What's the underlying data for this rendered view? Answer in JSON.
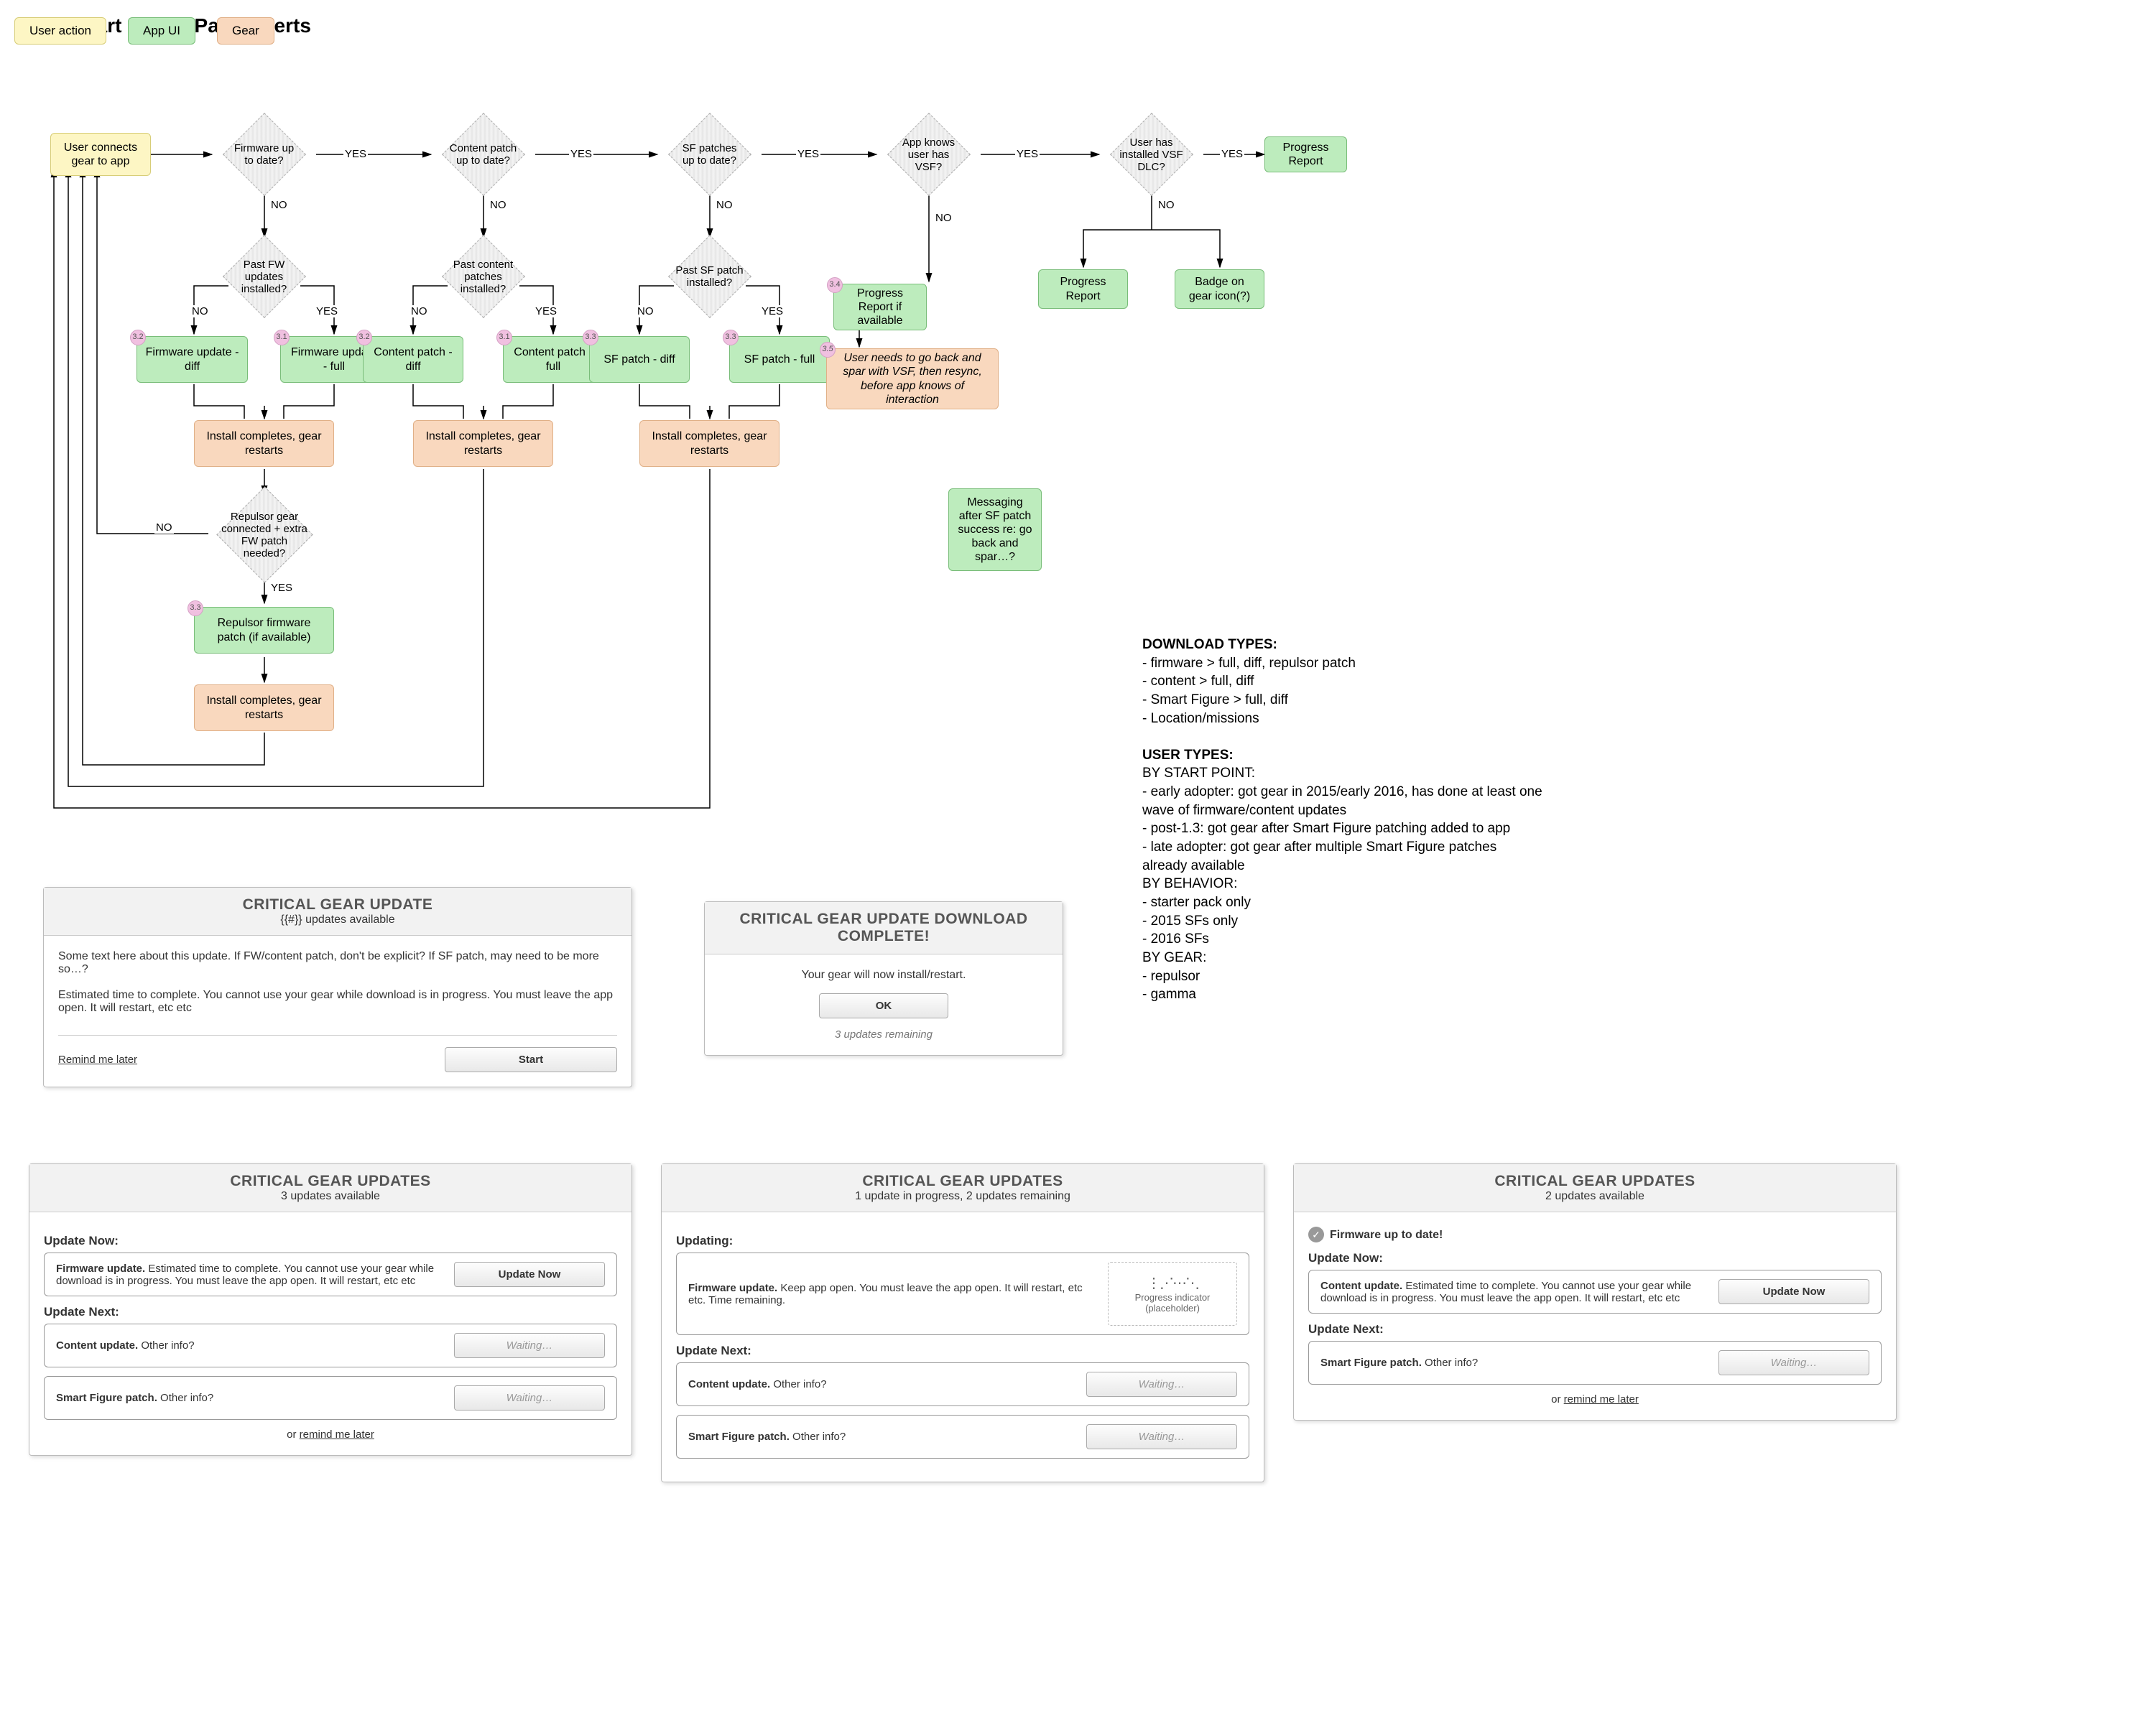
{
  "title": "2016 Smart Figure Patch Alerts",
  "legend": {
    "user_action": "User action",
    "app_ui": "App UI",
    "gear": "Gear"
  },
  "flow": {
    "start": "User connects gear to app",
    "d_firmware": "Firmware up to date?",
    "d_content": "Content patch up to date?",
    "d_sfpatch": "SF patches up to date?",
    "d_app_knows": "App knows user has VSF?",
    "d_dlc": "User has installed VSF DLC?",
    "end_progress": "Progress Report",
    "d_past_fw": "Past FW updates installed?",
    "d_past_content": "Past content patches installed?",
    "d_past_sf": "Past SF patch installed?",
    "fw_diff": "Firmware update - diff",
    "fw_full": "Firmware update - full",
    "content_diff": "Content patch - diff",
    "content_full": "Content patch - full",
    "sf_diff": "SF patch - diff",
    "sf_full": "SF patch - full",
    "install": "Install completes, gear restarts",
    "d_repulsor": "Repulsor gear connected + extra FW patch needed?",
    "repulsor_patch": "Repulsor firmware patch (if available)",
    "progress_if_avail": "Progress Report if available",
    "vsf_resync": "User needs to go back and spar with VSF, then resync, before app knows of interaction",
    "dlc_progress": "Progress Report",
    "dlc_badge": "Badge on gear icon(?)",
    "msg_after_sf": "Messaging after SF patch success re: go back and spar…?",
    "yes": "YES",
    "no": "NO",
    "badges": {
      "fw_diff": "3.2",
      "fw_full": "3.1",
      "content_diff": "3.2",
      "content_full": "3.1",
      "sf_diff": "3.3",
      "sf_full": "3.3",
      "repulsor": "3.3",
      "progress_if_avail": "3.4",
      "vsf_resync": "3.5"
    }
  },
  "notes": {
    "dl_h": "DOWNLOAD TYPES:",
    "dl_1": "- firmware > full, diff, repulsor patch",
    "dl_2": "- content > full, diff",
    "dl_3": "- Smart Figure > full, diff",
    "dl_4": "- Location/missions",
    "ut_h": "USER TYPES:",
    "ut_start_h": "BY START POINT:",
    "ut_start_1": "- early adopter: got gear in 2015/early 2016, has done at least one wave of firmware/content updates",
    "ut_start_2": "- post-1.3: got gear after Smart Figure patching added to app",
    "ut_start_3": "- late adopter: got gear after multiple Smart Figure patches already available",
    "ut_beh_h": "BY BEHAVIOR:",
    "ut_beh_1": "- starter pack only",
    "ut_beh_2": "- 2015 SFs only",
    "ut_beh_3": "- 2016 SFs",
    "ut_gear_h": "BY GEAR:",
    "ut_gear_1": "- repulsor",
    "ut_gear_2": "- gamma"
  },
  "mock1": {
    "title": "CRITICAL GEAR UPDATE",
    "sub": "{{#}} updates available",
    "body1": "Some text here about this update. If FW/content patch, don't be explicit? If SF patch, may need to be more so…?",
    "body2": "Estimated time to complete. You cannot use your gear while download is in progress. You must leave the app open. It will restart, etc etc",
    "remind": "Remind me later",
    "start": "Start"
  },
  "mock2": {
    "title": "CRITICAL GEAR UPDATE DOWNLOAD COMPLETE!",
    "body": "Your gear will now install/restart.",
    "ok": "OK",
    "remaining": "3 updates remaining"
  },
  "mock3": {
    "title": "CRITICAL GEAR UPDATES",
    "sub": "3 updates available",
    "update_now_h": "Update Now:",
    "row1_bold": "Firmware update.",
    "row1_rest": " Estimated time to complete. You cannot use your gear while download is in progress. You must leave the app open. It will restart, etc etc",
    "btn_update": "Update Now",
    "update_next_h": "Update Next:",
    "row2_bold": "Content update.",
    "row2_rest": " Other info?",
    "row3_bold": "Smart Figure patch.",
    "row3_rest": " Other info?",
    "waiting": "Waiting…",
    "footer_prefix": "or ",
    "footer_link": "remind me later"
  },
  "mock4": {
    "title": "CRITICAL GEAR UPDATES",
    "sub": "1 update in progress, 2 updates remaining",
    "updating_h": "Updating:",
    "row1_bold": "Firmware update.",
    "row1_rest": " Keep app open. You must leave the app open. It will restart, etc etc. Time remaining.",
    "placeholder_top": "Progress indicator",
    "placeholder_bot": "(placeholder)",
    "update_next_h": "Update Next:",
    "row2_bold": "Content update.",
    "row2_rest": " Other info?",
    "row3_bold": "Smart Figure patch.",
    "row3_rest": " Other info?",
    "waiting": "Waiting…"
  },
  "mock5": {
    "title": "CRITICAL GEAR UPDATES",
    "sub": "2 updates available",
    "done": "Firmware up to date!",
    "update_now_h": "Update Now:",
    "row1_bold": "Content update.",
    "row1_rest": " Estimated time to complete. You cannot use your gear while download is in progress. You must leave the app open. It will restart, etc etc",
    "btn_update": "Update Now",
    "update_next_h": "Update Next:",
    "row2_bold": "Smart Figure patch.",
    "row2_rest": " Other info?",
    "waiting": "Waiting…",
    "footer_prefix": "or ",
    "footer_link": "remind me later"
  }
}
